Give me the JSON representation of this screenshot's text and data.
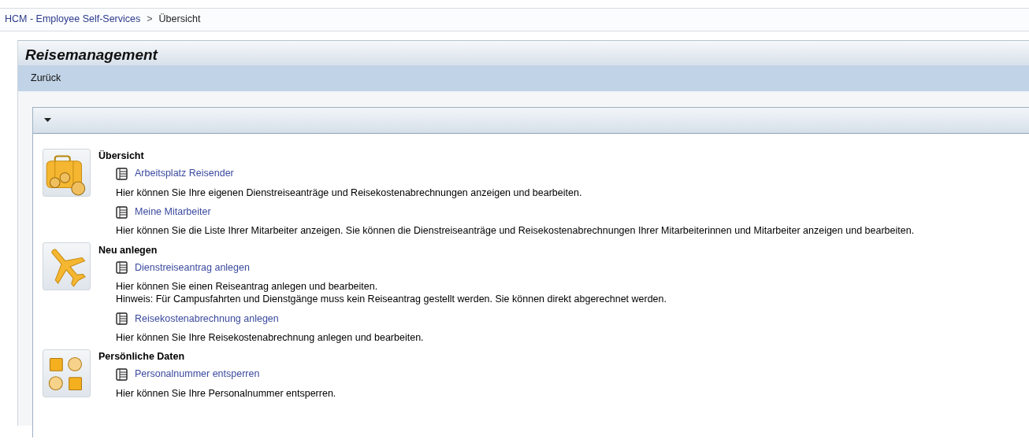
{
  "breadcrumb": [
    {
      "label": "HCM - Employee Self-Services",
      "kind": "link"
    },
    {
      "label": ">",
      "kind": "separator"
    },
    {
      "label": "Übersicht",
      "kind": "current"
    }
  ],
  "panel": {
    "title": "Reisemanagement",
    "toolbar": [
      "Zurück"
    ]
  },
  "sections": [
    {
      "title": "Übersicht",
      "kind": "suitcase",
      "entries": [
        {
          "link": "Arbeitsplatz Reisender",
          "description": [
            "Hier können Sie Ihre eigenen Dienstreiseanträge und Reisekostenabrechnungen anzeigen und bearbeiten."
          ]
        },
        {
          "link": "Meine Mitarbeiter",
          "description": [
            "Hier können Sie die Liste Ihrer Mitarbeiter anzeigen. Sie können die Dienstreiseanträge und Reisekostenabrechnungen Ihrer Mitarbeiterinnen und Mitarbeiter anzeigen und bearbeiten."
          ]
        }
      ]
    },
    {
      "title": "Neu anlegen",
      "kind": "plane",
      "entries": [
        {
          "link": "Dienstreiseantrag anlegen",
          "description": [
            "Hier können Sie einen Reiseantrag anlegen und bearbeiten.",
            "Hinweis: Für Campusfahrten und Dienstgänge muss kein Reiseantrag gestellt werden. Sie können direkt abgerechnet werden."
          ]
        },
        {
          "link": "Reisekostenabrechnung anlegen",
          "description": [
            "Hier können Sie Ihre Reisekostenabrechnung anlegen und bearbeiten."
          ]
        }
      ]
    },
    {
      "title": "Persönliche Daten",
      "kind": "shapes",
      "entries": [
        {
          "link": "Personalnummer entsperren",
          "description": [
            "Hier können Sie Ihre Personalnummer entsperren."
          ]
        }
      ]
    }
  ]
}
